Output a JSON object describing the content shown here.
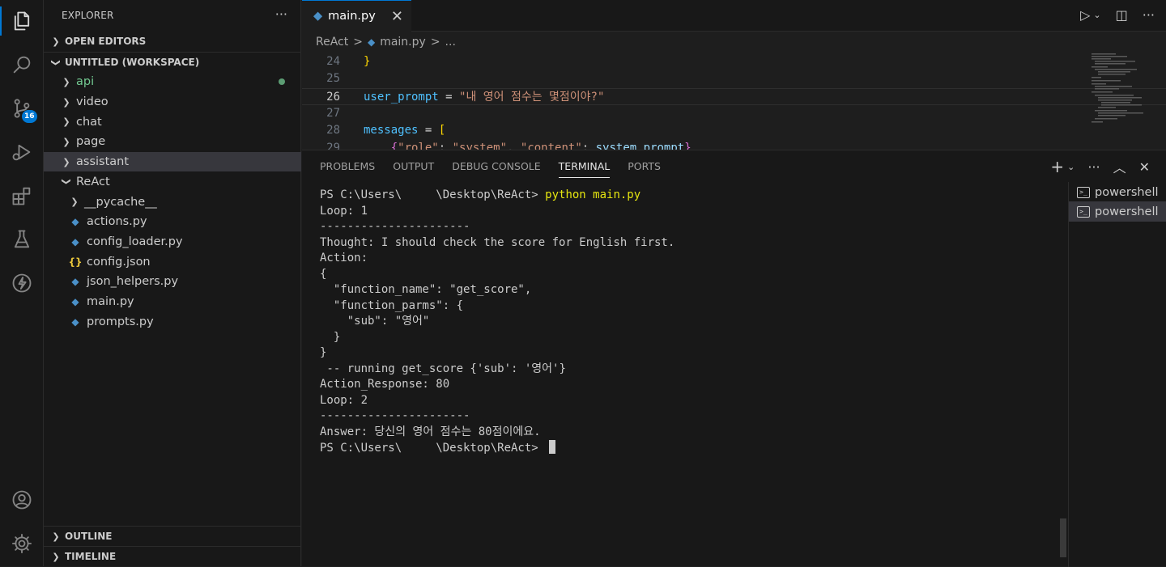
{
  "activity_bar": {
    "items": [
      {
        "icon": "files-icon"
      },
      {
        "icon": "search-icon"
      },
      {
        "icon": "source-control-icon",
        "badge": "16"
      },
      {
        "icon": "run-debug-icon"
      },
      {
        "icon": "extensions-icon"
      },
      {
        "icon": "testing-icon"
      },
      {
        "icon": "lightning-icon"
      },
      {
        "icon": "account-icon"
      },
      {
        "icon": "settings-gear-icon"
      }
    ]
  },
  "sidebar": {
    "title": "EXPLORER",
    "more": "···",
    "open_editors": "OPEN EDITORS",
    "workspace": "UNTITLED (WORKSPACE)",
    "tree": [
      {
        "label": "api",
        "type": "folder",
        "depth": 1,
        "color": "#73c991",
        "git_dot": true
      },
      {
        "label": "video",
        "type": "folder",
        "depth": 1
      },
      {
        "label": "chat",
        "type": "folder",
        "depth": 1
      },
      {
        "label": "page",
        "type": "folder",
        "depth": 1
      },
      {
        "label": "assistant",
        "type": "folder",
        "depth": 1,
        "selected": true
      },
      {
        "label": "ReAct",
        "type": "folder-open",
        "depth": 1
      },
      {
        "label": "__pycache__",
        "type": "folder",
        "depth": 2
      },
      {
        "label": "actions.py",
        "type": "py",
        "depth": 2
      },
      {
        "label": "config_loader.py",
        "type": "py",
        "depth": 2
      },
      {
        "label": "config.json",
        "type": "json",
        "depth": 2
      },
      {
        "label": "json_helpers.py",
        "type": "py",
        "depth": 2
      },
      {
        "label": "main.py",
        "type": "py",
        "depth": 2
      },
      {
        "label": "prompts.py",
        "type": "py",
        "depth": 2
      }
    ],
    "outline": "OUTLINE",
    "timeline": "TIMELINE"
  },
  "editor": {
    "tab_label": "main.py",
    "close_glyph": "✕",
    "breadcrumb": [
      "ReAct",
      ">",
      "main.py",
      ">",
      "..."
    ],
    "lines": [
      {
        "num": "24",
        "tokens": [
          {
            "t": "}",
            "c": "#ffd700"
          }
        ]
      },
      {
        "num": "25",
        "tokens": []
      },
      {
        "num": "26",
        "current": true,
        "tokens": [
          {
            "t": "user_prompt",
            "c": "#4fc1ff"
          },
          {
            "t": " = ",
            "c": "#d4d4d4"
          },
          {
            "t": "\"내 영어 점수는 몇점이야?\"",
            "c": "#ce9178"
          }
        ]
      },
      {
        "num": "27",
        "tokens": []
      },
      {
        "num": "28",
        "tokens": [
          {
            "t": "messages",
            "c": "#4fc1ff"
          },
          {
            "t": " = ",
            "c": "#d4d4d4"
          },
          {
            "t": "[",
            "c": "#ffd700"
          }
        ]
      },
      {
        "num": "29",
        "tokens": [
          {
            "t": "    ",
            "c": "#d4d4d4"
          },
          {
            "t": "{",
            "c": "#da70d6"
          },
          {
            "t": "\"role\"",
            "c": "#ce9178"
          },
          {
            "t": ": ",
            "c": "#d4d4d4"
          },
          {
            "t": "\"system\"",
            "c": "#ce9178"
          },
          {
            "t": ", ",
            "c": "#d4d4d4"
          },
          {
            "t": "\"content\"",
            "c": "#ce9178"
          },
          {
            "t": ": ",
            "c": "#d4d4d4"
          },
          {
            "t": "system_prompt",
            "c": "#9cdcfe"
          },
          {
            "t": "}",
            "c": "#da70d6"
          }
        ]
      }
    ]
  },
  "panel": {
    "tabs": [
      {
        "label": "PROBLEMS"
      },
      {
        "label": "OUTPUT"
      },
      {
        "label": "DEBUG CONSOLE"
      },
      {
        "label": "TERMINAL",
        "active": true
      },
      {
        "label": "PORTS"
      }
    ],
    "terminal_lines": [
      "PS C:\\Users\\     \\Desktop\\ReAct> ",
      "Loop: 1",
      "----------------------",
      "Thought: I should check the score for English first.",
      "Action:",
      "{",
      "  \"function_name\": \"get_score\",",
      "  \"function_parms\": {",
      "    \"sub\": \"영어\"",
      "  }",
      "}",
      " -- running get_score {'sub': '영어'}",
      "Action_Response: 80",
      "Loop: 2",
      "----------------------",
      "Answer: 당신의 영어 점수는 80점이에요.",
      "PS C:\\Users\\     \\Desktop\\ReAct> "
    ],
    "command": "python main.py",
    "terminals": [
      {
        "label": "powershell"
      },
      {
        "label": "powershell",
        "selected": true
      }
    ]
  }
}
